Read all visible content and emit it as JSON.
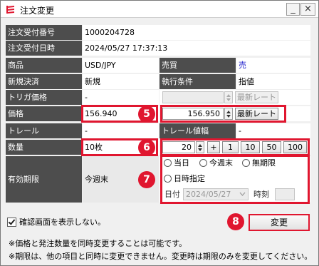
{
  "window": {
    "title": "注文変更",
    "minimize_label": "_",
    "close_label": "×"
  },
  "order": {
    "receipt_no_label": "注文受付番号",
    "receipt_no": "1000204728",
    "receipt_time_label": "注文受付日時",
    "receipt_time": "2024/05/27 17:37:13",
    "product_label": "商品",
    "product": "USD/JPY",
    "side_label": "売買",
    "side": "売",
    "side_color": "#2222cc",
    "new_settle_label": "新規決済",
    "new_settle": "新規",
    "exec_cond_label": "執行条件",
    "exec_cond": "指値",
    "trigger_label": "トリガ価格",
    "trigger": "-",
    "price_label": "価格",
    "price_current": "156.940",
    "price_new": "156.950",
    "latest_rate_label": "最新レート",
    "trail_label": "トレール",
    "trail": "-",
    "trail_width_label": "トレール値幅",
    "trail_width": "-",
    "qty_label": "数量",
    "qty_current": "10枚",
    "qty_new": "20",
    "qty_steps": [
      "+",
      "1",
      "10",
      "50",
      "100"
    ],
    "expiry_label": "有効期限",
    "expiry_current": "今週末",
    "expiry_options": [
      "当日",
      "今週末",
      "無期限",
      "日時指定"
    ],
    "date_label": "日付",
    "date_value": "2024/05/27",
    "time_label": "時刻",
    "time_value": ""
  },
  "confirm": {
    "label": "確認画面を表示しない。",
    "checked": true
  },
  "submit_label": "変更",
  "notes": [
    "※価格と発注数量を同時変更することは可能です。",
    "※期限は、他の項目と同時に変更できません。変更時は期限のみを変更してください。"
  ],
  "badges": [
    "5",
    "6",
    "7",
    "8"
  ],
  "accent_color": "#e0162f"
}
